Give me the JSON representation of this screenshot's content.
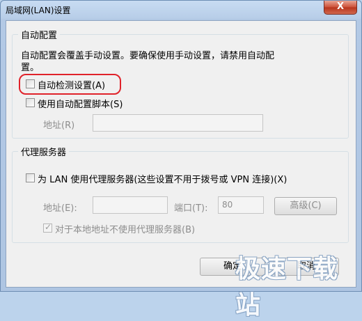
{
  "window": {
    "title": "局域网(LAN)设置",
    "close_label": "X"
  },
  "auto_config": {
    "group_title": "自动配置",
    "description_line1": "自动配置会覆盖手动设置。要确保使用手动设置，请禁用自动配",
    "description_line2": "置。",
    "auto_detect": {
      "label": "自动检测设置(A)",
      "checked": false
    },
    "use_script": {
      "label": "使用自动配置脚本(S)",
      "checked": false
    },
    "address_label": "地址(R)",
    "address_value": ""
  },
  "proxy": {
    "group_title": "代理服务器",
    "use_proxy": {
      "label": "为 LAN 使用代理服务器(这些设置不用于拨号或 VPN 连接)(X)",
      "checked": false
    },
    "address_label": "地址(E):",
    "address_value": "",
    "port_label": "端口(T):",
    "port_value": "80",
    "advanced_label": "高级(C)",
    "bypass_local": {
      "label": "对于本地地址不使用代理服务器(B)",
      "checked": true
    }
  },
  "buttons": {
    "ok_label": "确定",
    "cancel_label": "取消"
  },
  "watermark": "极速下载站"
}
